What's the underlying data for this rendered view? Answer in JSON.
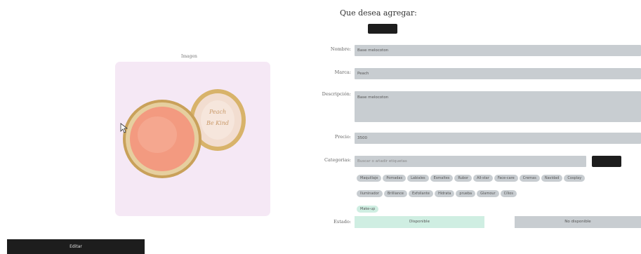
{
  "form": {
    "heading": "Que desea agregar:",
    "image_label": "Imagen",
    "nombre_label": "Nombre:",
    "nombre_value": "Base melocoton",
    "marca_label": "Marca:",
    "marca_value": "Peach",
    "descripcion_label": "Descripción:",
    "descripcion_value": "Base melocoton",
    "precio_label": "Precio:",
    "precio_value": "3500",
    "categorias_label": "Categorias:",
    "categorias_placeholder": "Buscar o añadir etiquetas",
    "estado_label": "Estado:",
    "disponible_label": "Disponible",
    "no_disponible_label": "No disponible",
    "edit_label": "Editar"
  },
  "chips": [
    {
      "label": "Maquillaje",
      "selected": false
    },
    {
      "label": "Pomadas",
      "selected": false
    },
    {
      "label": "Labiales",
      "selected": false
    },
    {
      "label": "Esmaltes",
      "selected": false
    },
    {
      "label": "Rubor",
      "selected": false
    },
    {
      "label": "All-star",
      "selected": false
    },
    {
      "label": "Face-care",
      "selected": false
    },
    {
      "label": "Cremas",
      "selected": false
    },
    {
      "label": "Navidad",
      "selected": false
    },
    {
      "label": "Cosplay",
      "selected": false
    },
    {
      "label": "Iluminador",
      "selected": false
    },
    {
      "label": "Brilliance",
      "selected": false
    },
    {
      "label": "Exfoliante",
      "selected": false
    },
    {
      "label": "Hidrata",
      "selected": false
    },
    {
      "label": "prueba",
      "selected": false
    },
    {
      "label": "Glamour",
      "selected": false
    },
    {
      "label": "Cílios",
      "selected": false
    },
    {
      "label": "Make-up",
      "selected": true
    }
  ],
  "colors": {
    "field_bg": "#c8cdd1",
    "dark_button": "#1d1d1d",
    "selected_chip": "#cfeee2",
    "image_bg": "#f5e8f5"
  }
}
